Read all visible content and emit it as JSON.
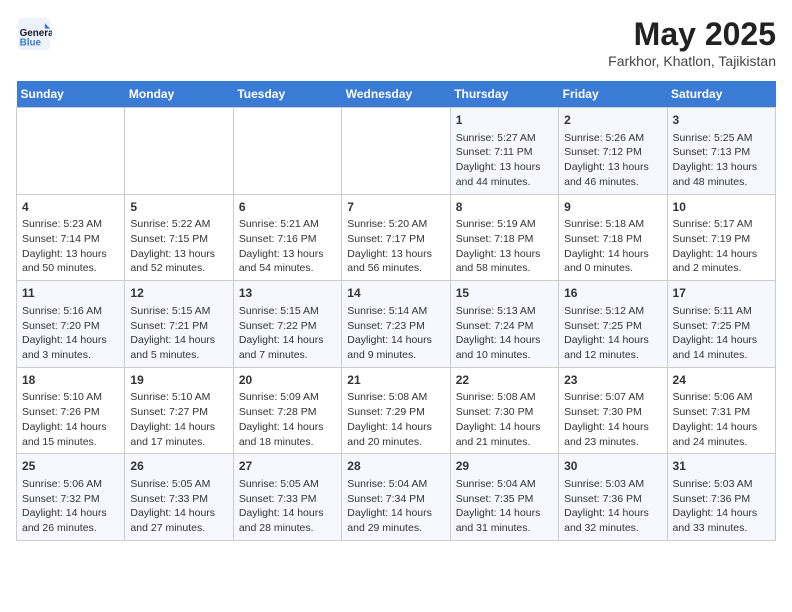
{
  "header": {
    "logo_line1": "General",
    "logo_line2": "Blue",
    "month_year": "May 2025",
    "location": "Farkhor, Khatlon, Tajikistan"
  },
  "days_of_week": [
    "Sunday",
    "Monday",
    "Tuesday",
    "Wednesday",
    "Thursday",
    "Friday",
    "Saturday"
  ],
  "weeks": [
    [
      {
        "num": "",
        "info": ""
      },
      {
        "num": "",
        "info": ""
      },
      {
        "num": "",
        "info": ""
      },
      {
        "num": "",
        "info": ""
      },
      {
        "num": "1",
        "info": "Sunrise: 5:27 AM\nSunset: 7:11 PM\nDaylight: 13 hours\nand 44 minutes."
      },
      {
        "num": "2",
        "info": "Sunrise: 5:26 AM\nSunset: 7:12 PM\nDaylight: 13 hours\nand 46 minutes."
      },
      {
        "num": "3",
        "info": "Sunrise: 5:25 AM\nSunset: 7:13 PM\nDaylight: 13 hours\nand 48 minutes."
      }
    ],
    [
      {
        "num": "4",
        "info": "Sunrise: 5:23 AM\nSunset: 7:14 PM\nDaylight: 13 hours\nand 50 minutes."
      },
      {
        "num": "5",
        "info": "Sunrise: 5:22 AM\nSunset: 7:15 PM\nDaylight: 13 hours\nand 52 minutes."
      },
      {
        "num": "6",
        "info": "Sunrise: 5:21 AM\nSunset: 7:16 PM\nDaylight: 13 hours\nand 54 minutes."
      },
      {
        "num": "7",
        "info": "Sunrise: 5:20 AM\nSunset: 7:17 PM\nDaylight: 13 hours\nand 56 minutes."
      },
      {
        "num": "8",
        "info": "Sunrise: 5:19 AM\nSunset: 7:18 PM\nDaylight: 13 hours\nand 58 minutes."
      },
      {
        "num": "9",
        "info": "Sunrise: 5:18 AM\nSunset: 7:18 PM\nDaylight: 14 hours\nand 0 minutes."
      },
      {
        "num": "10",
        "info": "Sunrise: 5:17 AM\nSunset: 7:19 PM\nDaylight: 14 hours\nand 2 minutes."
      }
    ],
    [
      {
        "num": "11",
        "info": "Sunrise: 5:16 AM\nSunset: 7:20 PM\nDaylight: 14 hours\nand 3 minutes."
      },
      {
        "num": "12",
        "info": "Sunrise: 5:15 AM\nSunset: 7:21 PM\nDaylight: 14 hours\nand 5 minutes."
      },
      {
        "num": "13",
        "info": "Sunrise: 5:15 AM\nSunset: 7:22 PM\nDaylight: 14 hours\nand 7 minutes."
      },
      {
        "num": "14",
        "info": "Sunrise: 5:14 AM\nSunset: 7:23 PM\nDaylight: 14 hours\nand 9 minutes."
      },
      {
        "num": "15",
        "info": "Sunrise: 5:13 AM\nSunset: 7:24 PM\nDaylight: 14 hours\nand 10 minutes."
      },
      {
        "num": "16",
        "info": "Sunrise: 5:12 AM\nSunset: 7:25 PM\nDaylight: 14 hours\nand 12 minutes."
      },
      {
        "num": "17",
        "info": "Sunrise: 5:11 AM\nSunset: 7:25 PM\nDaylight: 14 hours\nand 14 minutes."
      }
    ],
    [
      {
        "num": "18",
        "info": "Sunrise: 5:10 AM\nSunset: 7:26 PM\nDaylight: 14 hours\nand 15 minutes."
      },
      {
        "num": "19",
        "info": "Sunrise: 5:10 AM\nSunset: 7:27 PM\nDaylight: 14 hours\nand 17 minutes."
      },
      {
        "num": "20",
        "info": "Sunrise: 5:09 AM\nSunset: 7:28 PM\nDaylight: 14 hours\nand 18 minutes."
      },
      {
        "num": "21",
        "info": "Sunrise: 5:08 AM\nSunset: 7:29 PM\nDaylight: 14 hours\nand 20 minutes."
      },
      {
        "num": "22",
        "info": "Sunrise: 5:08 AM\nSunset: 7:30 PM\nDaylight: 14 hours\nand 21 minutes."
      },
      {
        "num": "23",
        "info": "Sunrise: 5:07 AM\nSunset: 7:30 PM\nDaylight: 14 hours\nand 23 minutes."
      },
      {
        "num": "24",
        "info": "Sunrise: 5:06 AM\nSunset: 7:31 PM\nDaylight: 14 hours\nand 24 minutes."
      }
    ],
    [
      {
        "num": "25",
        "info": "Sunrise: 5:06 AM\nSunset: 7:32 PM\nDaylight: 14 hours\nand 26 minutes."
      },
      {
        "num": "26",
        "info": "Sunrise: 5:05 AM\nSunset: 7:33 PM\nDaylight: 14 hours\nand 27 minutes."
      },
      {
        "num": "27",
        "info": "Sunrise: 5:05 AM\nSunset: 7:33 PM\nDaylight: 14 hours\nand 28 minutes."
      },
      {
        "num": "28",
        "info": "Sunrise: 5:04 AM\nSunset: 7:34 PM\nDaylight: 14 hours\nand 29 minutes."
      },
      {
        "num": "29",
        "info": "Sunrise: 5:04 AM\nSunset: 7:35 PM\nDaylight: 14 hours\nand 31 minutes."
      },
      {
        "num": "30",
        "info": "Sunrise: 5:03 AM\nSunset: 7:36 PM\nDaylight: 14 hours\nand 32 minutes."
      },
      {
        "num": "31",
        "info": "Sunrise: 5:03 AM\nSunset: 7:36 PM\nDaylight: 14 hours\nand 33 minutes."
      }
    ]
  ]
}
